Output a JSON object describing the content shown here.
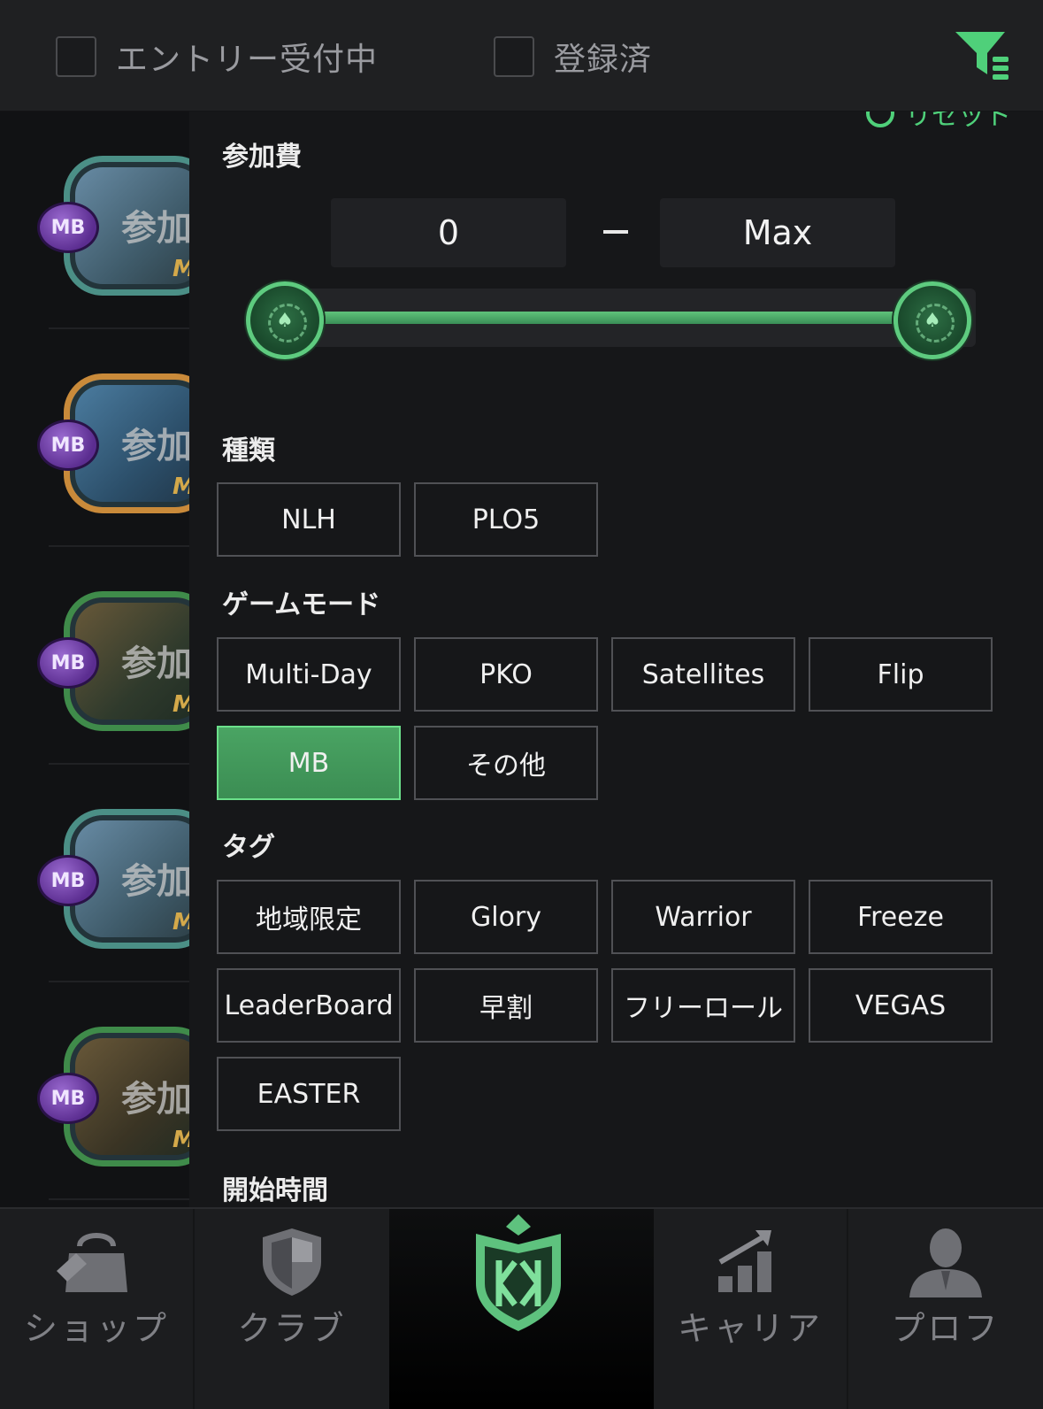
{
  "topbar": {
    "entry_open_label": "エントリー受付中",
    "registered_label": "登録済"
  },
  "panel": {
    "reset_label": "リセット",
    "fee": {
      "title": "参加費",
      "min_value": "0",
      "max_value": "Max",
      "slider_min_fraction": 0,
      "slider_max_fraction": 1
    },
    "type": {
      "title": "種類",
      "options": [
        "NLH",
        "PLO5"
      ]
    },
    "game_mode": {
      "title": "ゲームモード",
      "options": [
        "Multi-Day",
        "PKO",
        "Satellites",
        "Flip",
        "MB",
        "その他"
      ],
      "selected": "MB"
    },
    "tags": {
      "title": "タグ",
      "options": [
        "地域限定",
        "Glory",
        "Warrior",
        "Freeze",
        "LeaderBoard",
        "早割",
        "フリーロール",
        "VEGAS",
        "EASTER"
      ]
    },
    "start_time": {
      "title": "開始時間"
    }
  },
  "background_list": {
    "ticket_text": "参加",
    "badge_text": "MB",
    "corner_letter": "M"
  },
  "bottomnav": {
    "items": [
      {
        "label": "ショップ",
        "icon": "shopping-bag-icon"
      },
      {
        "label": "クラブ",
        "icon": "shield-icon"
      },
      {
        "label": "",
        "icon": "kk-logo-icon"
      },
      {
        "label": "キャリア",
        "icon": "chart-growth-icon"
      },
      {
        "label": "プロフ",
        "icon": "profile-icon"
      }
    ]
  },
  "colors": {
    "accent_green": "#4aa463",
    "accent_green_light": "#6be08a",
    "panel_bg": "#161719",
    "topbar_bg": "#1f2022"
  }
}
